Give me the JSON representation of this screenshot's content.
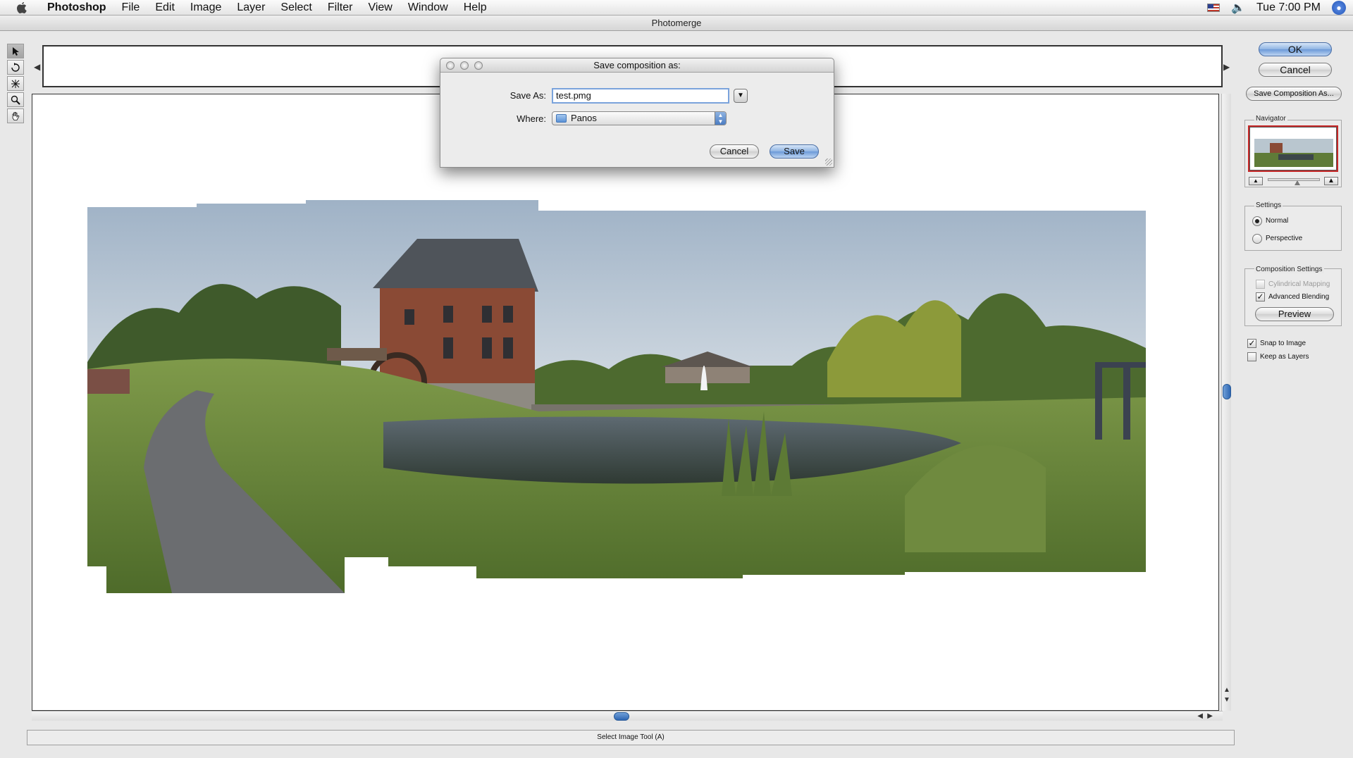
{
  "menubar": {
    "items": [
      "Photoshop",
      "File",
      "Edit",
      "Image",
      "Layer",
      "Select",
      "Filter",
      "View",
      "Window",
      "Help"
    ],
    "clock": "Tue 7:00 PM"
  },
  "window": {
    "title": "Photomerge"
  },
  "tools": [
    "select-image-tool",
    "rotate-image-tool",
    "set-vanishing-point-tool",
    "zoom-tool",
    "hand-tool"
  ],
  "right_panel": {
    "ok_label": "OK",
    "cancel_label": "Cancel",
    "save_composition_label": "Save Composition As...",
    "navigator_title": "Navigator",
    "settings": {
      "title": "Settings",
      "options": [
        "Normal",
        "Perspective"
      ],
      "selected": "Normal"
    },
    "composition_settings": {
      "title": "Composition Settings",
      "cylindrical_mapping": "Cylindrical Mapping",
      "advanced_blending": "Advanced Blending",
      "preview_label": "Preview"
    },
    "snap_to_image": "Snap to Image",
    "keep_as_layers": "Keep as Layers"
  },
  "dialog": {
    "title": "Save composition as:",
    "save_as_label": "Save As:",
    "save_as_value": "test.pmg",
    "where_label": "Where:",
    "where_value": "Panos",
    "cancel_label": "Cancel",
    "save_label": "Save"
  },
  "status": {
    "text": "Select Image Tool (A)"
  },
  "colors": {
    "accent_blue": "#6c9ad8",
    "navigator_frame": "#c62828"
  }
}
